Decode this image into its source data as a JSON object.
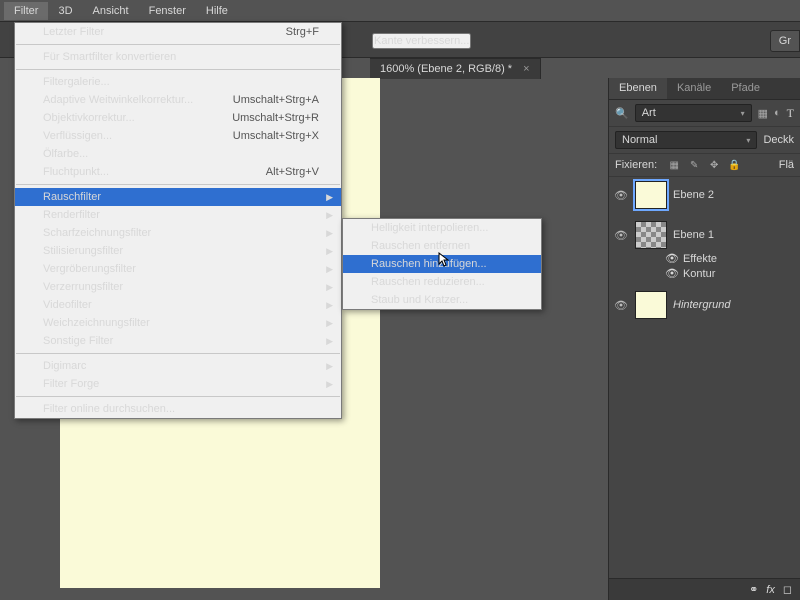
{
  "menubar": {
    "items": [
      "Filter",
      "3D",
      "Ansicht",
      "Fenster",
      "Hilfe"
    ]
  },
  "toolbar": {
    "btn_refine": "Kante verbessern...",
    "btn_gr": "Gr"
  },
  "doc_tab": {
    "title": "1600% (Ebene 2, RGB/8) *"
  },
  "panels": {
    "tabs": [
      "Ebenen",
      "Kanäle",
      "Pfade"
    ],
    "kind_dropdown": "Art",
    "blend_dropdown": "Normal",
    "opacity_label": "Deckk",
    "lock_label": "Fixieren:",
    "fill_label": "Flä",
    "layers": [
      {
        "name": "Ebene 2",
        "visible": true,
        "selected": true,
        "thumb": "solid"
      },
      {
        "name": "Ebene 1",
        "visible": true,
        "selected": false,
        "thumb": "check",
        "fx": [
          {
            "label": "Effekte"
          },
          {
            "label": "Kontur"
          }
        ]
      },
      {
        "name": "Hintergrund",
        "visible": true,
        "selected": false,
        "thumb": "solid",
        "italic": true
      }
    ],
    "footer_fx": "fx"
  },
  "menu_main": {
    "group0": [
      {
        "label": "Letzter Filter",
        "shortcut": "Strg+F",
        "disabled": true
      }
    ],
    "group1": [
      {
        "label": "Für Smartfilter konvertieren"
      }
    ],
    "group2": [
      {
        "label": "Filtergalerie..."
      },
      {
        "label": "Adaptive Weitwinkelkorrektur...",
        "shortcut": "Umschalt+Strg+A"
      },
      {
        "label": "Objektivkorrektur...",
        "shortcut": "Umschalt+Strg+R"
      },
      {
        "label": "Verflüssigen...",
        "shortcut": "Umschalt+Strg+X"
      },
      {
        "label": "Ölfarbe..."
      },
      {
        "label": "Fluchtpunkt...",
        "shortcut": "Alt+Strg+V"
      }
    ],
    "group3": [
      {
        "label": "Rauschfilter",
        "submenu": true,
        "hl": true
      },
      {
        "label": "Renderfilter",
        "submenu": true
      },
      {
        "label": "Scharfzeichnungsfilter",
        "submenu": true
      },
      {
        "label": "Stilisierungsfilter",
        "submenu": true
      },
      {
        "label": "Vergröberungsfilter",
        "submenu": true
      },
      {
        "label": "Verzerrungsfilter",
        "submenu": true
      },
      {
        "label": "Videofilter",
        "submenu": true
      },
      {
        "label": "Weichzeichnungsfilter",
        "submenu": true
      },
      {
        "label": "Sonstige Filter",
        "submenu": true
      }
    ],
    "group4": [
      {
        "label": "Digimarc",
        "submenu": true
      },
      {
        "label": "Filter Forge",
        "submenu": true
      }
    ],
    "group5": [
      {
        "label": "Filter online durchsuchen..."
      }
    ]
  },
  "menu_sub": {
    "items": [
      {
        "label": "Helligkeit interpolieren..."
      },
      {
        "label": "Rauschen entfernen"
      },
      {
        "label": "Rauschen hinzufügen...",
        "hl": true
      },
      {
        "label": "Rauschen reduzieren..."
      },
      {
        "label": "Staub und Kratzer..."
      }
    ]
  }
}
